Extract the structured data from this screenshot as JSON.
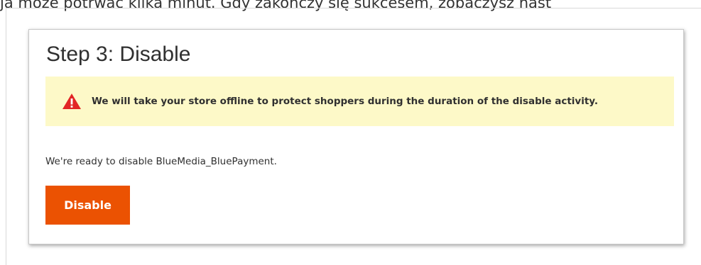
{
  "page": {
    "top_text": "ja może potrwać kilka minut. Gdy zakończy się sukcesem, zobaczysz nast"
  },
  "card": {
    "title": "Step 3: Disable",
    "warning": {
      "icon": "warning-triangle-icon",
      "text": "We will take your store offline to protect shoppers during the duration of the disable activity."
    },
    "ready_text": "We're ready to disable BlueMedia_BluePayment.",
    "button_label": "Disable"
  },
  "colors": {
    "accent": "#eb5202",
    "warning_background": "#fdf9c8",
    "warning_icon": "#e22626"
  }
}
